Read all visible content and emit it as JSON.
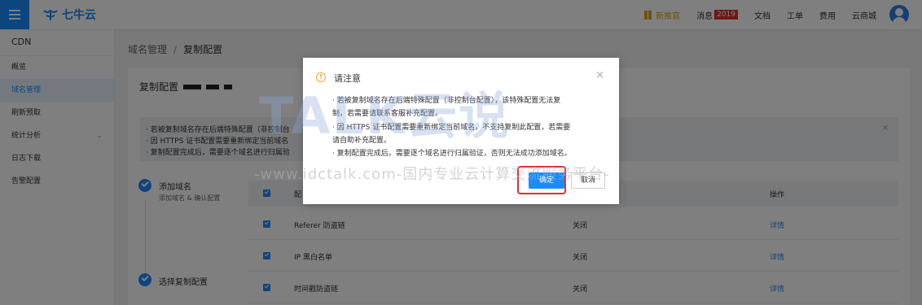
{
  "topbar": {
    "brand": "七牛云",
    "nav": {
      "gift": "新推官",
      "messages": "消息",
      "messages_badge": "2019",
      "docs": "文档",
      "tickets": "工单",
      "billing": "费用",
      "store": "云商城"
    }
  },
  "sidebar": {
    "header": "CDN",
    "items": [
      {
        "label": "概览"
      },
      {
        "label": "域名管理",
        "active": true
      },
      {
        "label": "刷新预取"
      },
      {
        "label": "统计分析",
        "has_submenu": true
      },
      {
        "label": "日志下载"
      },
      {
        "label": "告警配置"
      }
    ]
  },
  "breadcrumb": {
    "parent": "域名管理",
    "separator": "/",
    "current": "复制配置"
  },
  "card": {
    "title": "复制配置",
    "notice": [
      "· 若被复制域名存在后端特殊配置（非控制台",
      "· 因 HTTPS 证书配置需要重新绑定当前域名",
      "· 复制配置完成后，需要逐个域名进行归属验"
    ]
  },
  "steps": [
    {
      "title": "添加域名",
      "subtitle": "添加域名 & 确认配置"
    },
    {
      "title": "选择复制配置"
    }
  ],
  "table": {
    "header": {
      "config": "配",
      "status": "",
      "action": "操作"
    },
    "rows": [
      {
        "name": "Referer 防盗链",
        "status": "关闭",
        "action": "详情"
      },
      {
        "name": "IP 黑白名单",
        "status": "关闭",
        "action": "详情"
      },
      {
        "name": "时间戳防盗链",
        "status": "关闭",
        "action": "详情"
      }
    ]
  },
  "modal": {
    "title": "请注意",
    "lines": [
      "· 若被复制域名存在后端特殊配置（非控制台配置），该特殊配置无法复",
      "制，若需要请联系客服补充配置。",
      "· 因 HTTPS 证书配置需要重新绑定当前域名，不支持复制此配置，若需要",
      "请自助补充配置。",
      "· 复制配置完成后，需要逐个域名进行归属验证，否则无法成功添加域名。"
    ],
    "ok": "确定",
    "cancel": "取消",
    "close_glyph": "×",
    "warn_glyph": "!"
  },
  "watermark": {
    "big": "TALK云说",
    "line": "-www.idctalk.com-国内专业云计算交流服务平台-"
  },
  "colors": {
    "primary": "#1a8cff",
    "highlight": "#e52e2e",
    "warning": "#f5a623"
  }
}
